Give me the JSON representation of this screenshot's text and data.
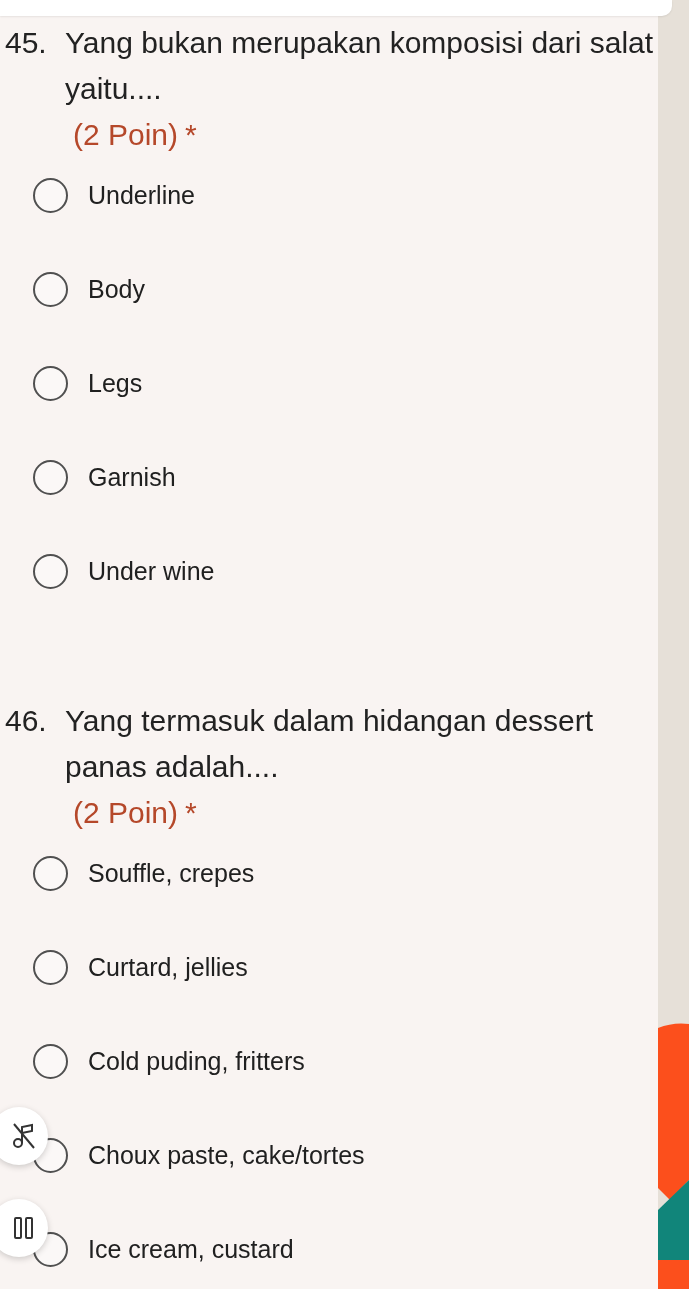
{
  "questions": [
    {
      "number": "45.",
      "text": "Yang bukan merupakan komposisi dari salat yaitu....",
      "points": "(2 Poin)",
      "required": "*",
      "options": [
        {
          "label": "Underline",
          "selected": false
        },
        {
          "label": "Body",
          "selected": false
        },
        {
          "label": "Legs",
          "selected": false
        },
        {
          "label": "Garnish",
          "selected": false
        },
        {
          "label": "Under wine",
          "selected": false
        }
      ]
    },
    {
      "number": "46.",
      "text": "Yang termasuk dalam hidangan dessert panas adalah....",
      "points": "(2 Poin)",
      "required": "*",
      "options": [
        {
          "label": "Souffle, crepes",
          "selected": false
        },
        {
          "label": "Curtard, jellies",
          "selected": false
        },
        {
          "label": "Cold puding, fritters",
          "selected": false
        },
        {
          "label": "Choux paste, cake/tortes",
          "selected": false
        },
        {
          "label": "Ice cream, custard",
          "selected": false
        }
      ]
    }
  ],
  "media_controls": [
    {
      "kind": "mute"
    },
    {
      "kind": "pause"
    }
  ]
}
